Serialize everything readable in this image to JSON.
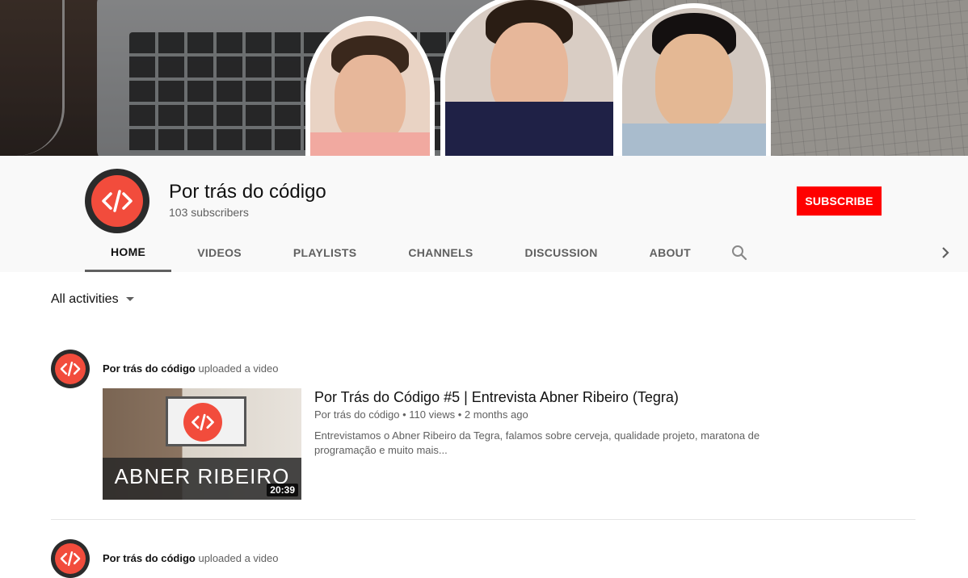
{
  "channel": {
    "name": "Por trás do código",
    "subscribers": "103 subscribers",
    "subscribe_label": "SUBSCRIBE"
  },
  "tabs": [
    {
      "label": "HOME",
      "active": true
    },
    {
      "label": "VIDEOS",
      "active": false
    },
    {
      "label": "PLAYLISTS",
      "active": false
    },
    {
      "label": "CHANNELS",
      "active": false
    },
    {
      "label": "DISCUSSION",
      "active": false
    },
    {
      "label": "ABOUT",
      "active": false
    }
  ],
  "filter": {
    "label": "All activities"
  },
  "feed": [
    {
      "author": "Por trás do código",
      "action": "uploaded a video",
      "video": {
        "title": "Por Trás do Código #5 | Entrevista Abner Ribeiro (Tegra)",
        "meta": "Por trás do código • 110 views • 2 months ago",
        "description": "Entrevistamos o Abner Ribeiro da Tegra, falamos sobre cerveja, qualidade projeto, maratona de programação e muito mais...",
        "thumbnail_text": "ABNER RIBEIRO",
        "duration": "20:39"
      }
    },
    {
      "author": "Por trás do código",
      "action": "uploaded a video"
    }
  ],
  "colors": {
    "brand_red": "#f24c3c",
    "subscribe_red": "#ff0000",
    "header_bg": "#f9f9f9"
  },
  "icons": {
    "logo": "code-brackets-icon",
    "search": "search-icon",
    "dropdown": "caret-down-icon",
    "next": "chevron-right-icon"
  }
}
